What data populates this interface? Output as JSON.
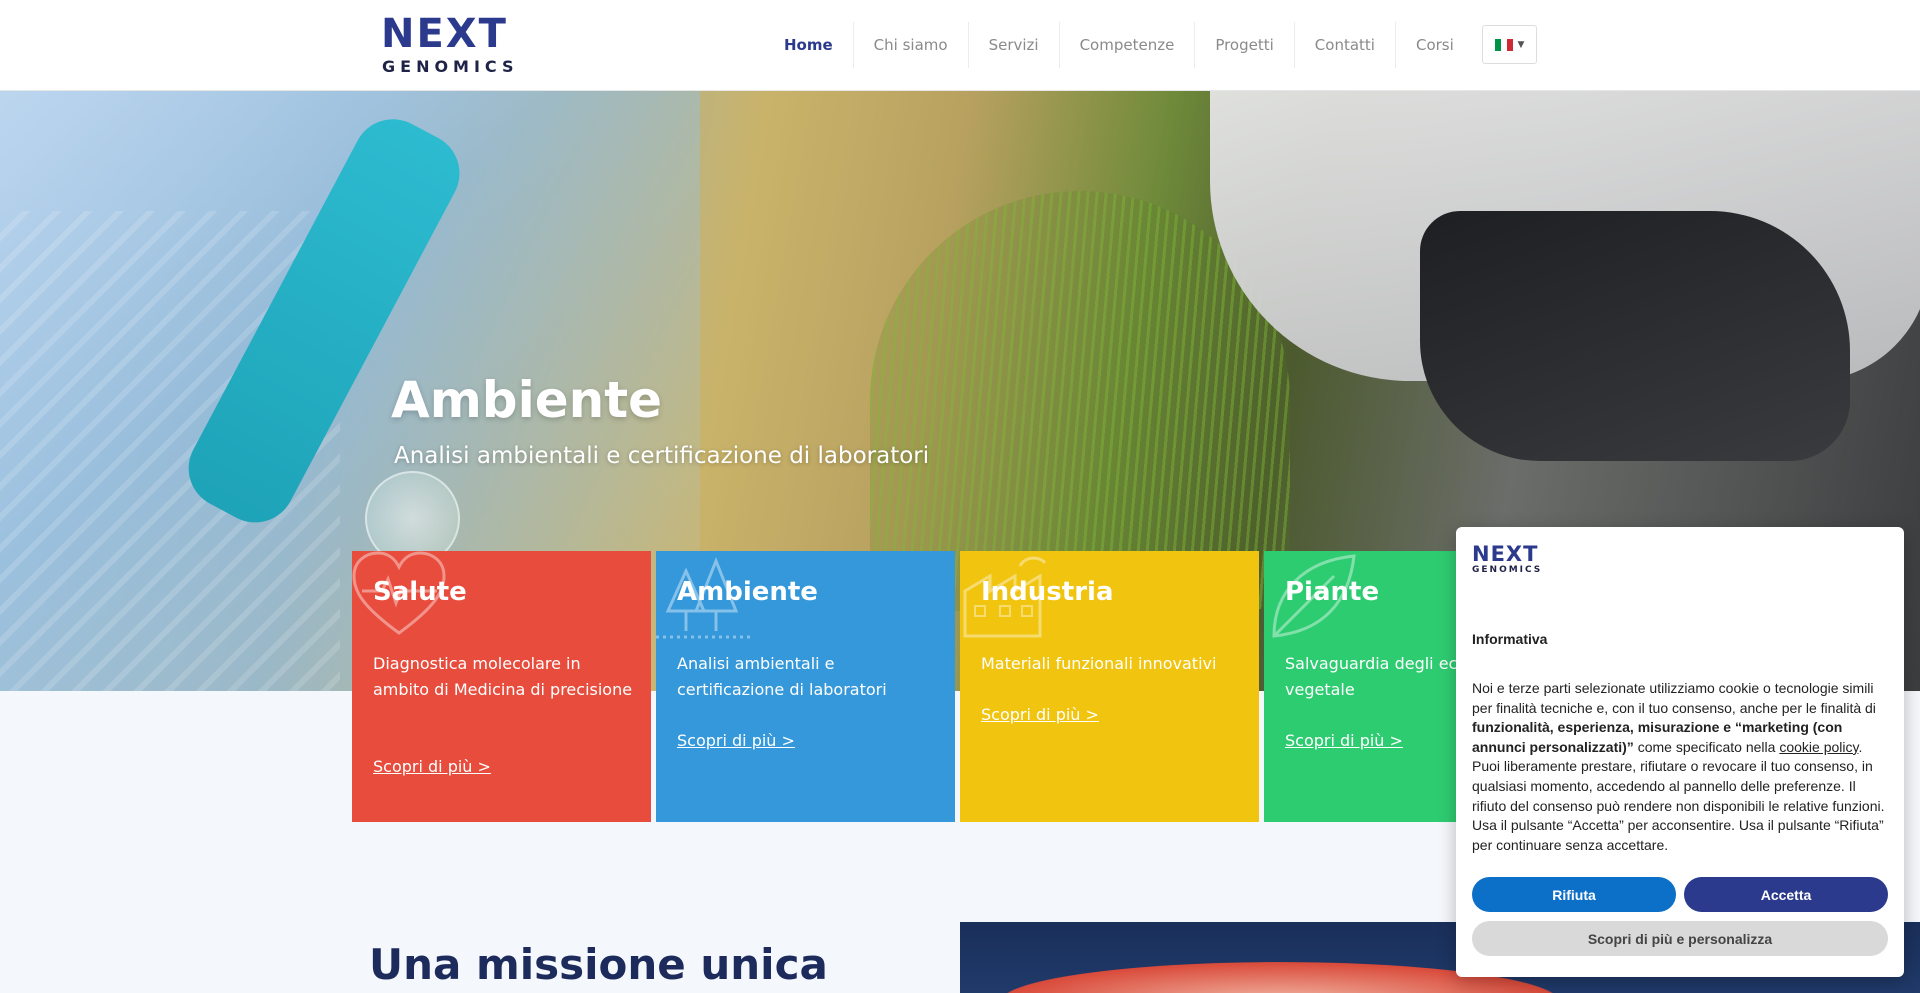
{
  "header": {
    "logo_line1": "NEXT",
    "logo_line2": "GENOMICS",
    "nav": [
      "Home",
      "Chi siamo",
      "Servizi",
      "Competenze",
      "Progetti",
      "Contatti",
      "Corsi"
    ],
    "active_nav": "Home",
    "language": "IT"
  },
  "hero": {
    "title": "Ambiente",
    "subtitle": "Analisi ambientali e certificazione di laboratori"
  },
  "cards": [
    {
      "title": "Salute",
      "desc": "Diagnostica molecolare in ambito di Medicina di precisione",
      "link": "Scopri di più >",
      "color": "#e84c3d",
      "icon": "heart-icon"
    },
    {
      "title": "Ambiente",
      "desc": "Analisi ambientali e certificazione di laboratori",
      "link": "Scopri di più >",
      "color": "#3498db",
      "icon": "trees-icon"
    },
    {
      "title": "Industria",
      "desc": "Materiali funzionali innovativi",
      "link": "Scopri di più >",
      "color": "#f1c40f",
      "icon": "factory-icon"
    },
    {
      "title": "Piante",
      "desc": "Salvaguardia degli ec patologia vegetale",
      "link": "Scopri di più >",
      "color": "#2ecc71",
      "icon": "leaf-icon"
    }
  ],
  "mission": {
    "title": "Una missione unica"
  },
  "cookie": {
    "logo_line1": "NEXT",
    "logo_line2": "GENOMICS",
    "title": "Informativa",
    "text_1": "Noi e terze parti selezionate utilizziamo cookie o tecnologie simili per finalità tecniche e, con il tuo consenso, anche per le finalità di ",
    "text_bold": "funzionalità, esperienza, misurazione e “marketing (con annunci personalizzati)”",
    "text_2": " come specificato nella ",
    "text_link": "cookie policy",
    "text_3": ". Puoi liberamente prestare, rifiutare o revocare il tuo consenso, in qualsiasi momento, accedendo al pannello delle preferenze. Il rifiuto del consenso può rendere non disponibili le relative funzioni. Usa il pulsante “Accetta” per acconsentire. Usa il pulsante “Rifiuta” per continuare senza accettare.",
    "reject_label": "Rifiuta",
    "accept_label": "Accetta",
    "more_label": "Scopri di più e personalizza"
  }
}
